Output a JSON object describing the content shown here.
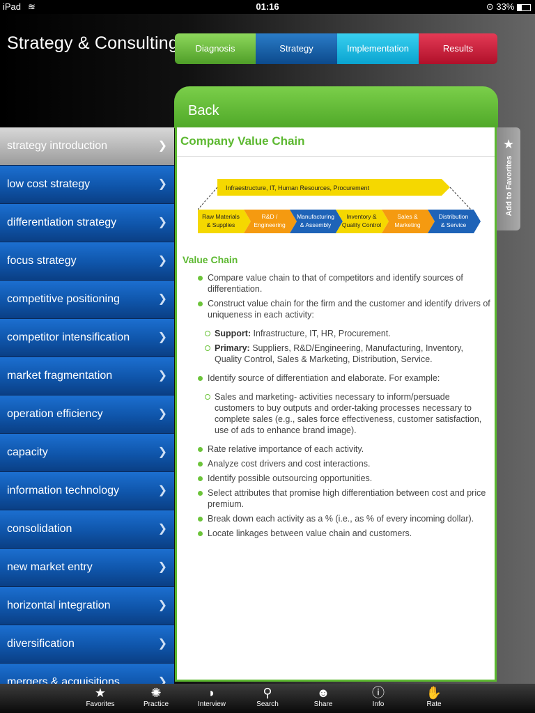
{
  "status": {
    "device": "iPad",
    "time": "01:16",
    "battery": "33%"
  },
  "app_title": "Strategy & Consulting",
  "top_tabs": [
    {
      "label": "Diagnosis"
    },
    {
      "label": "Strategy"
    },
    {
      "label": "Implementation"
    },
    {
      "label": "Results"
    }
  ],
  "sidebar": {
    "items": [
      {
        "label": "strategy introduction"
      },
      {
        "label": "low cost strategy"
      },
      {
        "label": "differentiation strategy"
      },
      {
        "label": "focus strategy"
      },
      {
        "label": "competitive positioning"
      },
      {
        "label": "competitor intensification"
      },
      {
        "label": "market fragmentation"
      },
      {
        "label": "operation efficiency"
      },
      {
        "label": "capacity"
      },
      {
        "label": "information technology"
      },
      {
        "label": "consolidation"
      },
      {
        "label": "new market entry"
      },
      {
        "label": "horizontal integration"
      },
      {
        "label": "diversification"
      },
      {
        "label": "mergers & acquisitions"
      }
    ]
  },
  "panel": {
    "back_label": "Back",
    "title": "Company Value Chain",
    "diagram": {
      "top_bar": "Infraestructure, IT, Human Resources, Procurement",
      "chevrons": [
        {
          "line1": "Raw Materials",
          "line2": "& Supplies",
          "color": "#f5d800"
        },
        {
          "line1": "R&D /",
          "line2": "Engineering",
          "color": "#f59a10"
        },
        {
          "line1": "Manufacturing",
          "line2": "& Assembly",
          "color": "#1e63b8"
        },
        {
          "line1": "Inventory &",
          "line2": "Quality Control",
          "color": "#f5d800"
        },
        {
          "line1": "Sales &",
          "line2": "Marketing",
          "color": "#f59a10"
        },
        {
          "line1": "Distribution",
          "line2": "& Service",
          "color": "#1e63b8"
        }
      ]
    },
    "section_title": "Value Chain",
    "bullet_1": "Compare value chain to that of competitors and identify sources of differentiation.",
    "bullet_2": "Construct value chain for the firm and the customer and identify drivers of uniqueness in each activity:",
    "sub_support_label": "Support:",
    "sub_support_text": " Infrastructure, IT, HR, Procurement.",
    "sub_primary_label": "Primary:",
    "sub_primary_text": " Suppliers, R&D/Engineering, Manufacturing, Inventory, Quality Control, Sales & Marketing, Distribution, Service.",
    "bullet_3": "Identify source of differentiation and elaborate. For example:",
    "sub_example": "Sales and marketing- activities necessary to inform/persuade customers to buy outputs and order-taking processes necessary to complete sales (e.g., sales force effectiveness, customer satisfaction, use of ads to enhance brand image).",
    "bullet_4": "Rate relative importance of each activity.",
    "bullet_5": "Analyze cost drivers and cost interactions.",
    "bullet_6": "Identify possible outsourcing opportunities.",
    "bullet_7": "Select attributes that promise high differentiation between cost and price premium.",
    "bullet_8": "Break down each activity as a % (i.e., as % of every incoming dollar).",
    "bullet_9": "Locate linkages between value chain and customers."
  },
  "favorites_tab": {
    "label": "Add to Favorites"
  },
  "tabbar": [
    {
      "label": "Favorites",
      "icon": "star-icon"
    },
    {
      "label": "Practice",
      "icon": "brain-icon"
    },
    {
      "label": "Interview",
      "icon": "chat-icon"
    },
    {
      "label": "Search",
      "icon": "search-icon"
    },
    {
      "label": "Share",
      "icon": "people-icon"
    },
    {
      "label": "Info",
      "icon": "info-icon"
    },
    {
      "label": "Rate",
      "icon": "thumbs-up-icon"
    }
  ]
}
